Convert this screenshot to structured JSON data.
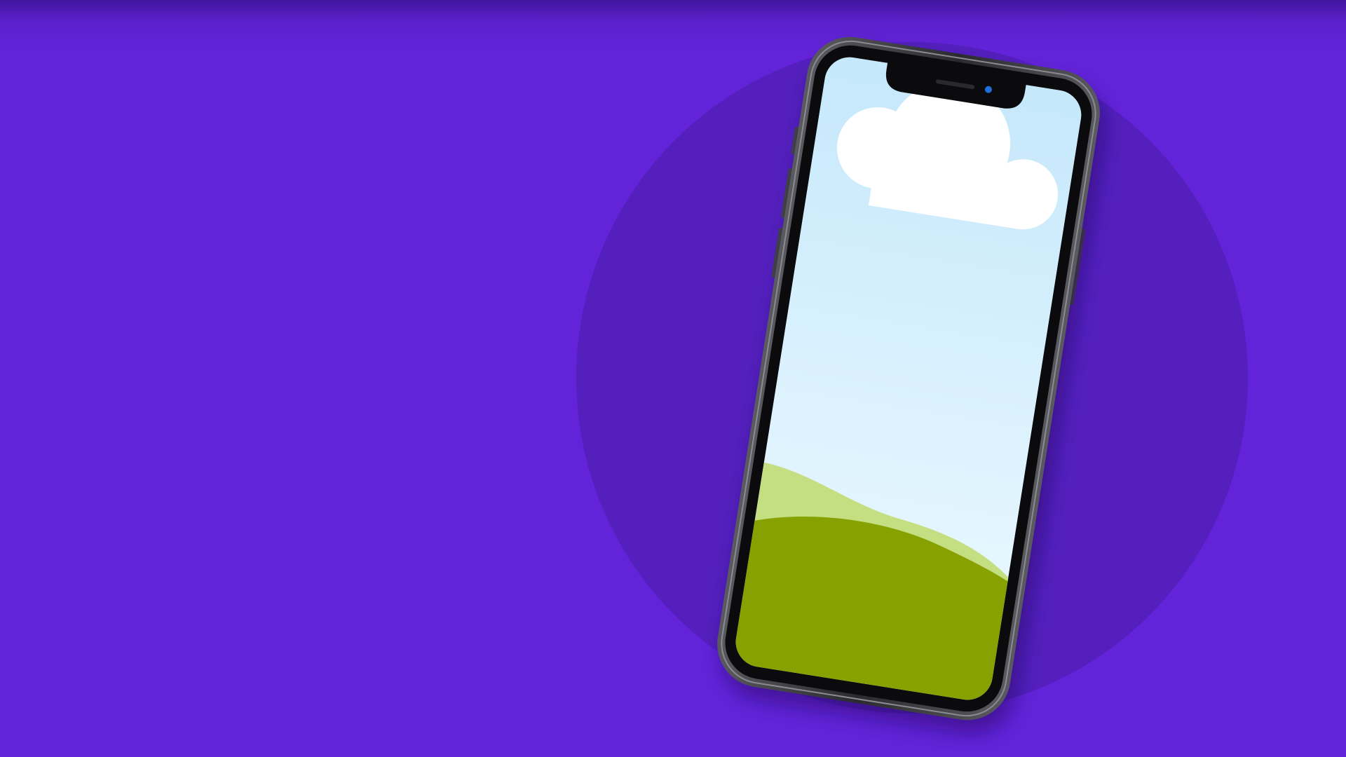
{
  "scene": {
    "background_color": "#6323d9",
    "circle_color": "#541fbd",
    "phone": {
      "frame_color": "#2b2b2f",
      "bezel_color": "#0b0b0d",
      "screen": {
        "sky_top": "#c5e8fb",
        "sky_bottom": "#eefaff",
        "cloud_color": "#ffffff",
        "hill_back_color": "#c4de82",
        "hill_front_color": "#87a200"
      },
      "camera_color": "#1e6fd9"
    }
  }
}
